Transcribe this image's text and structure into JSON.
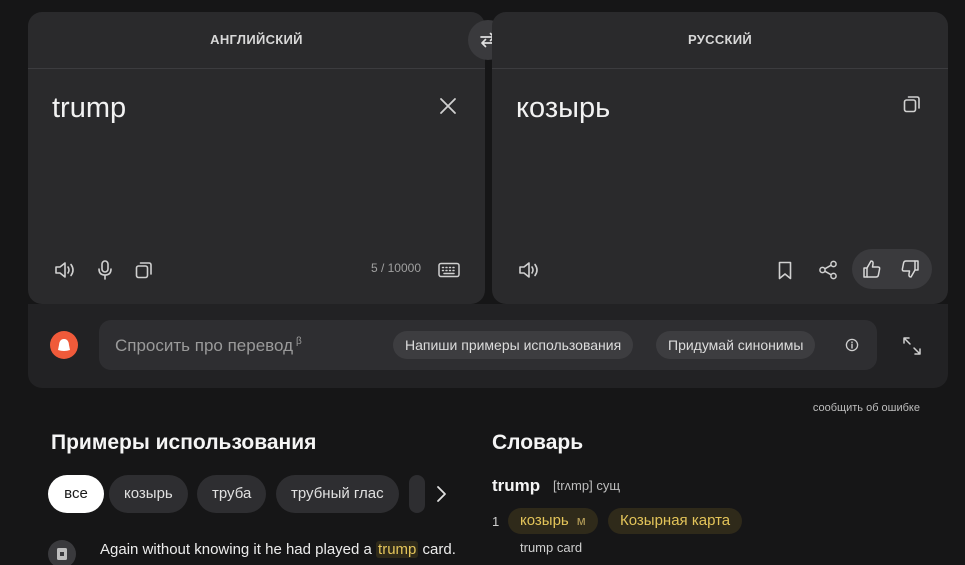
{
  "source": {
    "language": "АНГЛИЙСКИЙ",
    "text": "trump",
    "char_count": "5 / 10000"
  },
  "target": {
    "language": "РУССКИЙ",
    "text": "козырь"
  },
  "ask": {
    "placeholder": "Спросить про перевод",
    "beta": "β",
    "chips": [
      "Напиши примеры использования",
      "Придумай синонимы"
    ]
  },
  "report_link": "сообщить об ошибке",
  "examples": {
    "title": "Примеры использования",
    "filters": [
      "все",
      "козырь",
      "труба",
      "трубный глас",
      ""
    ],
    "active_filter": "все",
    "items": [
      {
        "before": "Again without knowing it he had played a ",
        "highlight": "trump",
        "after": " card."
      }
    ]
  },
  "dictionary": {
    "title": "Словарь",
    "word": "trump",
    "transcription": "[trʌmp] сущ",
    "entries": [
      {
        "num": "1",
        "translations": [
          {
            "text": "козырь",
            "gram": "м"
          },
          {
            "text": "Козырная карта",
            "gram": ""
          }
        ],
        "example": "trump card"
      }
    ]
  },
  "icons": {
    "swap": "swap-arrows-icon",
    "clear": "close-icon",
    "speaker": "speaker-icon",
    "mic": "microphone-icon",
    "copy": "copy-icon",
    "keyboard": "keyboard-icon",
    "bookmark": "bookmark-icon",
    "share": "share-icon",
    "like": "thumbs-up-icon",
    "dislike": "thumbs-down-icon",
    "info": "info-icon",
    "expand": "expand-icon",
    "alice": "alice-logo-icon",
    "chevron": "chevron-right-icon"
  },
  "colors": {
    "background": "#161617",
    "panel": "#2a2a2c",
    "highlight": "#e3c45a",
    "alice": "#f05a3a",
    "active_chip": "#ffffff"
  }
}
